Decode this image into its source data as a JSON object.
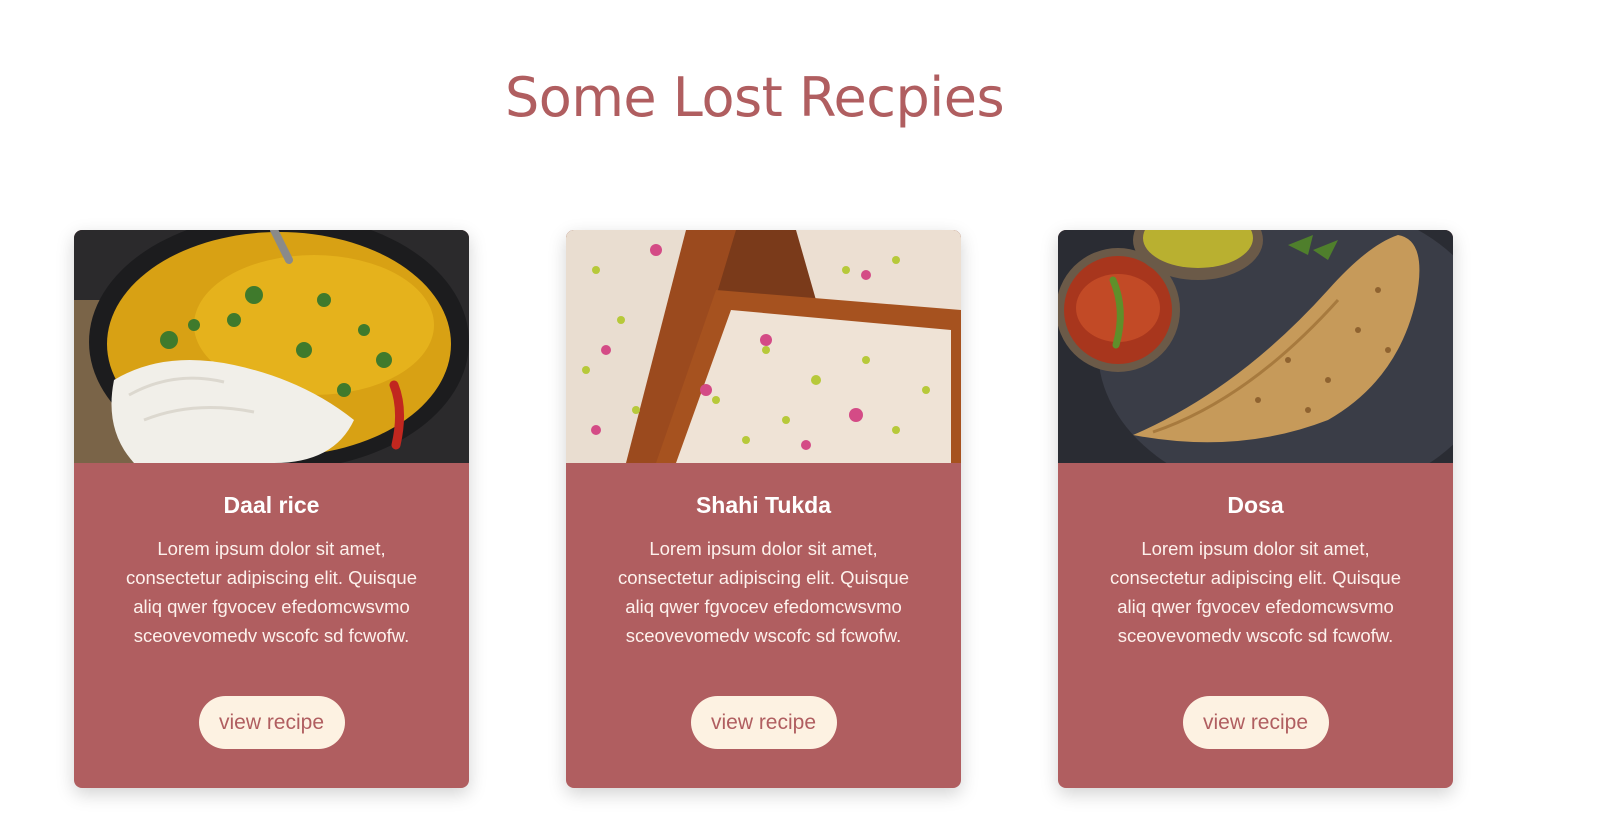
{
  "page": {
    "title": "Some Lost Recpies"
  },
  "colors": {
    "accent": "#b05e60",
    "button_bg": "#fdf2e2",
    "background": "#ffffff"
  },
  "cards": [
    {
      "image_name": "daal-rice-photo",
      "title": "Daal rice",
      "description": "Lorem ipsum dolor sit amet, consectetur adipiscing elit. Quisque aliq qwer fgvocev efedomcwsvmo sceovevomedv wscofc sd fcwofw.",
      "button_label": "view recipe"
    },
    {
      "image_name": "shahi-tukda-photo",
      "title": "Shahi Tukda",
      "description": "Lorem ipsum dolor sit amet, consectetur adipiscing elit. Quisque aliq qwer fgvocev efedomcwsvmo sceovevomedv wscofc sd fcwofw.",
      "button_label": "view recipe"
    },
    {
      "image_name": "dosa-photo",
      "title": "Dosa",
      "description": "Lorem ipsum dolor sit amet, consectetur adipiscing elit. Quisque aliq qwer fgvocev efedomcwsvmo sceovevomedv wscofc sd fcwofw.",
      "button_label": "view recipe"
    }
  ]
}
